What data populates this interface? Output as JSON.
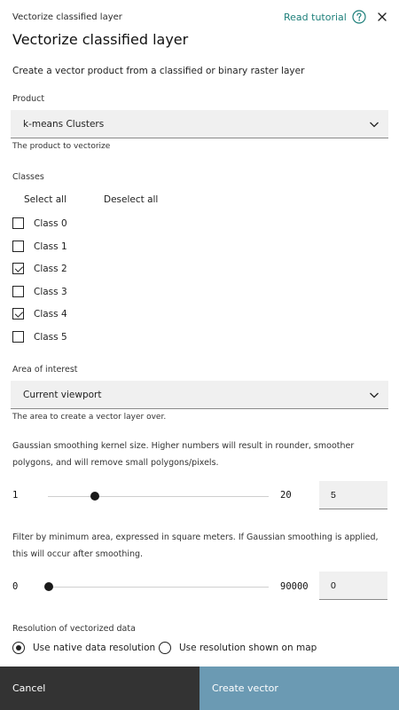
{
  "header": {
    "breadcrumb": "Vectorize classified layer",
    "read_tutorial": "Read tutorial",
    "title": "Vectorize classified layer"
  },
  "description": "Create a vector product from a classified or binary raster layer",
  "product": {
    "label": "Product",
    "value": "k-means Clusters",
    "helper": "The product to vectorize"
  },
  "classes": {
    "label": "Classes",
    "select_all": "Select all",
    "deselect_all": "Deselect all",
    "items": [
      {
        "label": "Class 0",
        "checked": false
      },
      {
        "label": "Class 1",
        "checked": false
      },
      {
        "label": "Class 2",
        "checked": true
      },
      {
        "label": "Class 3",
        "checked": false
      },
      {
        "label": "Class 4",
        "checked": true
      },
      {
        "label": "Class 5",
        "checked": false
      }
    ]
  },
  "area_of_interest": {
    "label": "Area of interest",
    "value": "Current viewport",
    "helper": "The area to create a vector layer over."
  },
  "smoothing": {
    "description": "Gaussian smoothing kernel size. Higher numbers will result in rounder, smoother polygons, and will remove small polygons/pixels.",
    "min": "1",
    "max": "20",
    "value": "5"
  },
  "min_area": {
    "description": "Filter by minimum area, expressed in square meters. If Gaussian smoothing is applied, this will occur after smoothing.",
    "min": "0",
    "max": "90000",
    "value": "0"
  },
  "resolution": {
    "label": "Resolution of vectorized data",
    "options": [
      {
        "label": "Use native data resolution",
        "selected": true
      },
      {
        "label": "Use resolution shown on map",
        "selected": false
      }
    ]
  },
  "footer": {
    "cancel": "Cancel",
    "create": "Create vector"
  },
  "colors": {
    "accent": "#1d7f7a",
    "footer_cancel_bg": "#333333",
    "footer_create_bg": "#6b9ab3",
    "field_bg": "#f0f0f0"
  }
}
